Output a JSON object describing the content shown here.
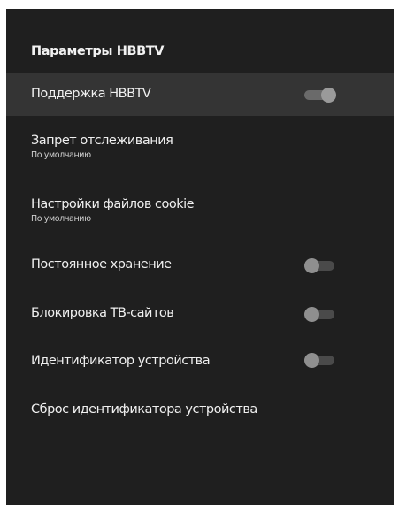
{
  "panel": {
    "title": "Параметры HBBTV"
  },
  "items": [
    {
      "label": "Поддержка HBBTV",
      "toggle": "on",
      "focused": true
    },
    {
      "label": "Запрет отслеживания",
      "sublabel": "По умолчанию"
    },
    {
      "label": "Настройки файлов cookie",
      "sublabel": "По умолчанию"
    },
    {
      "label": "Постоянное хранение",
      "toggle": "off"
    },
    {
      "label": "Блокировка ТВ-сайтов",
      "toggle": "off"
    },
    {
      "label": "Идентификатор устройства",
      "toggle": "off"
    },
    {
      "label": "Сброс идентификатора устройства"
    }
  ]
}
